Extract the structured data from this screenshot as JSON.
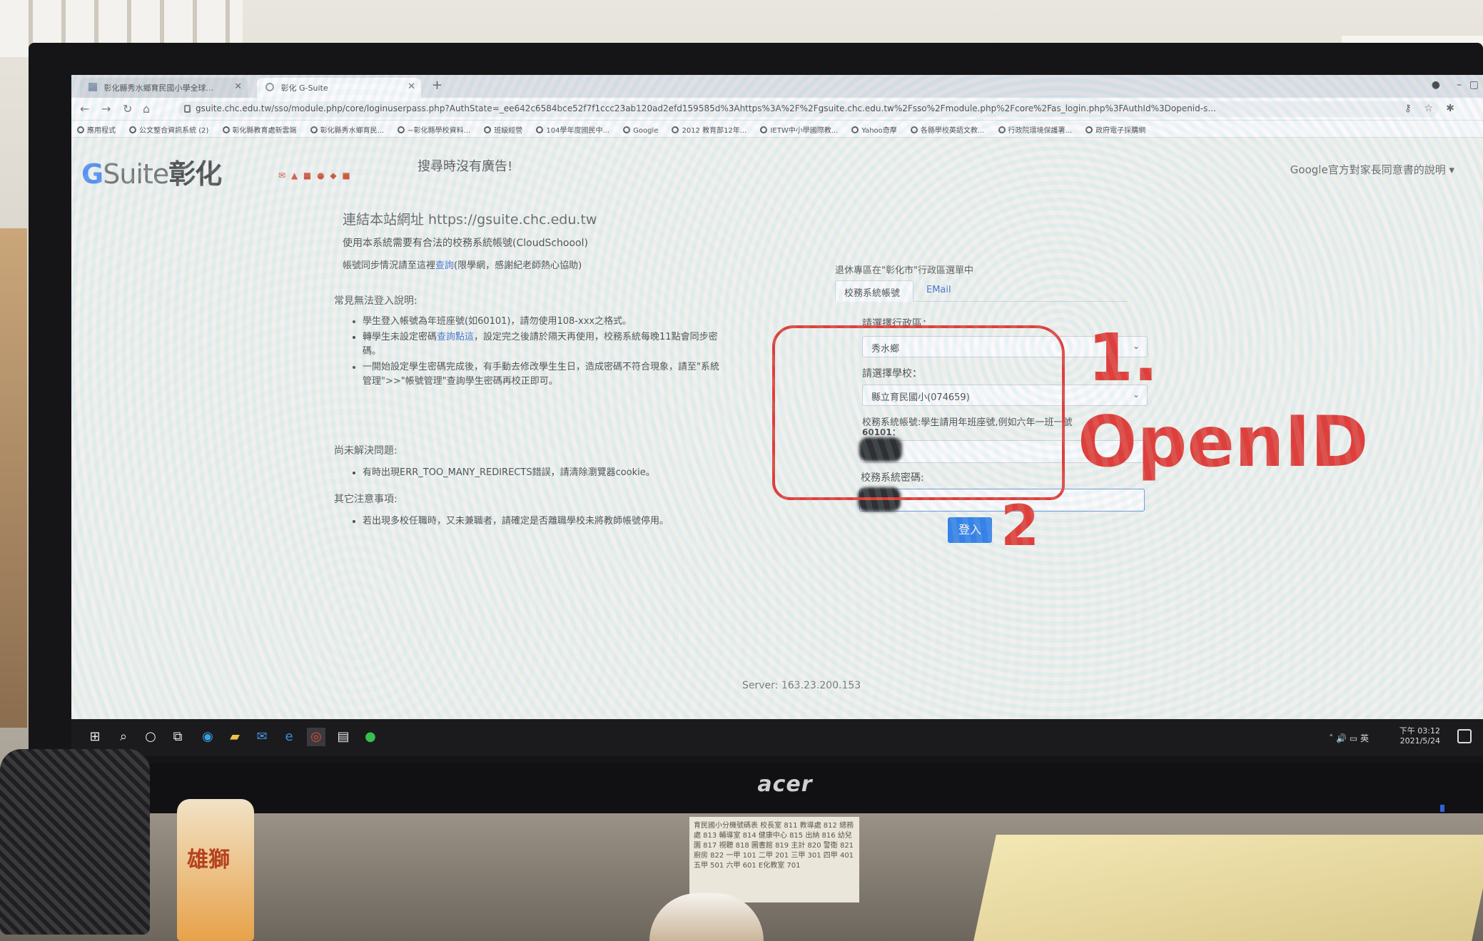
{
  "browser": {
    "tabs": [
      {
        "label": "彰化縣秀水鄉育民國小學全球..."
      },
      {
        "label": "彰化 G-Suite"
      }
    ],
    "new_tab": "+",
    "address": "gsuite.chc.edu.tw/sso/module.php/core/loginuserpass.php?AuthState=_ee642c6584bce52f7f1ccc23ab120ad2efd159585d%3Ahttps%3A%2F%2Fgsuite.chc.edu.tw%2Fsso%2Fmodule.php%2Fcore%2Fas_login.php%3FAuthId%3Dopenid-s...",
    "bookmarks": [
      "應用程式",
      "公文整合資訊系統 (2)",
      "彰化縣教育處新雲端",
      "彰化縣秀水鄉育民...",
      "~彰化縣學校資料...",
      "班級經營",
      "104學年度國民中...",
      "Google",
      "2012 教育部12年...",
      "IETW中小學國際教...",
      "Yahoo奇摩",
      "各縣學校英語文教...",
      "行政院環境保護署...",
      "政府電子採購網"
    ]
  },
  "header": {
    "logo_g": "G",
    "logo_suite": "Suite",
    "logo_chhua": "彰化",
    "ad_note": "搜尋時沒有廣告!",
    "right_link": "Google官方對家長同意書的說明 ▾"
  },
  "info": {
    "site_url": "連結本站網址 https://gsuite.chc.edu.tw",
    "notice_1": "使用本系統需要有合法的校務系統帳號(CloudSchoool)",
    "notice_2_pre": "帳號同步情況請至這裡",
    "notice_2_link": "查詢",
    "notice_2_post": "(限學網，感謝紀老師熱心協助)",
    "faq_title": "常見無法登入說明:",
    "faq_1": "學生登入帳號為年班座號(如60101)，請勿使用108-xxx之格式。",
    "faq_2_pre": "轉學生未設定密碼",
    "faq_2_link": "查詢點這",
    "faq_2_post": "，設定完之後請於隔天再使用，校務系統每晚11點會同步密碼。",
    "faq_3": "一開始設定學生密碼完成後，有手動去修改學生生日，造成密碼不符合現象，請至\"系統管理\">>\"帳號管理\"查詢學生密碼再校正即可。",
    "unresolved_title": "尚未解決問題:",
    "unresolved_1": "有時出現ERR_TOO_MANY_REDIRECTS錯誤，請清除瀏覽器cookie。",
    "other_title": "其它注意事項:",
    "other_1": "若出現多校任職時，又未兼職者，請確定是否離職學校未將教師帳號停用。"
  },
  "login": {
    "retired_note": "退休專區在\"彰化市\"行政區選單中",
    "tab_school": "校務系統帳號",
    "tab_email": "EMail",
    "district_label": "請選擇行政區：",
    "district_value": "秀水鄉",
    "school_label": "請選擇學校：",
    "school_value": "縣立育民國小(074659)",
    "account_label": "校務系統帳號:學生請用年班座號,例如六年一班一號",
    "account_example": "60101：",
    "password_label": "校務系統密碼:",
    "submit": "登入"
  },
  "server": "Server: 163.23.200.153",
  "annotations": {
    "step1": "1.",
    "openid": "OpenID",
    "step2": "2"
  },
  "taskbar": {
    "time": "下午 03:12",
    "date": "2021/5/24",
    "ime": "英"
  },
  "monitor_brand": "acer",
  "desk": {
    "bottle_label": "雄獅",
    "note_card": "育民國小分機號碼表 校長室 811 教導處 812 總務處 813 輔導室 814 健康中心 815 出納 816 幼兒園 817 視聽 818 圖書館 819 主計 820 警衛 821 廚房 822 一甲 101 二甲 201 三甲 301 四甲 401 五甲 501 六甲 601 E化教室 701"
  },
  "colors": {
    "annotation_red": "#e3231b",
    "primary_blue": "#1a73e8",
    "link_blue": "#2a62c9"
  }
}
